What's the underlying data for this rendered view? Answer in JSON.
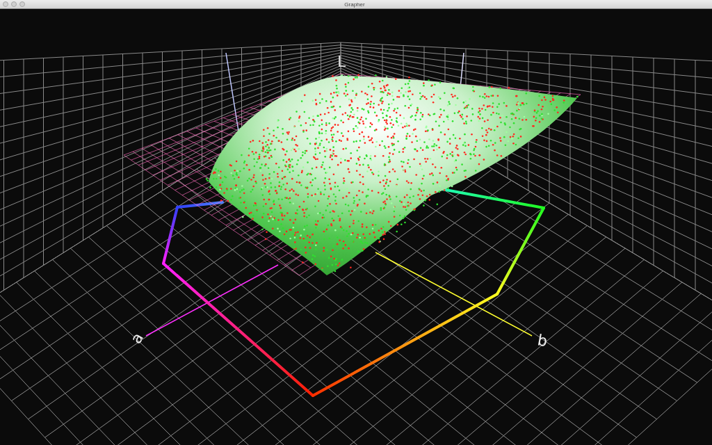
{
  "window": {
    "title": "Grapher"
  },
  "plot": {
    "axis_labels": [
      "L",
      "a",
      "b"
    ]
  }
}
